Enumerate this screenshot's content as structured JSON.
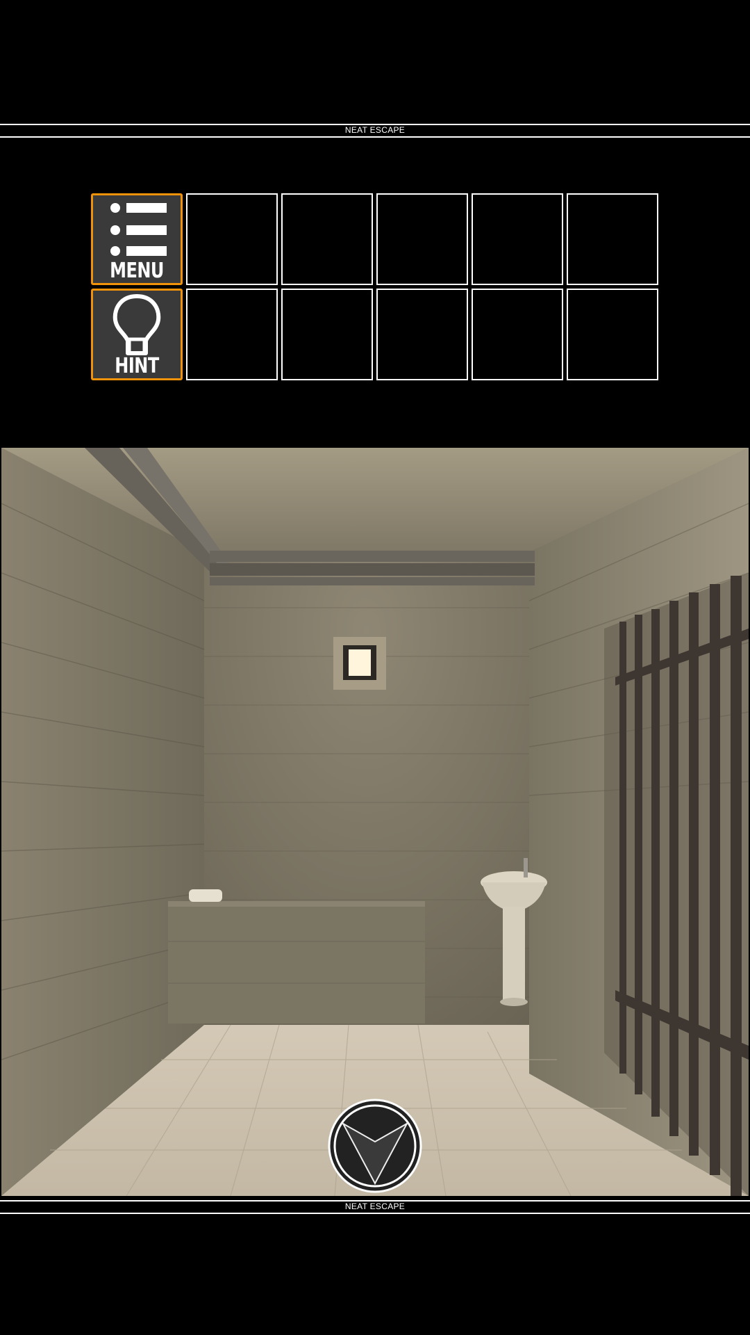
{
  "header": {
    "brand": "NEAT ESCAPE"
  },
  "footer": {
    "brand": "NEAT ESCAPE"
  },
  "menu_button": {
    "label": "MENU",
    "icon": "list-icon",
    "border_color": "#f0920a"
  },
  "hint_button": {
    "label": "HINT",
    "icon": "lightbulb-icon",
    "border_color": "#f0920a"
  },
  "inventory": {
    "rows": 2,
    "slots_per_row": 5,
    "items": []
  },
  "scene": {
    "name": "prison cell",
    "navigation": "arrow-down-icon"
  }
}
